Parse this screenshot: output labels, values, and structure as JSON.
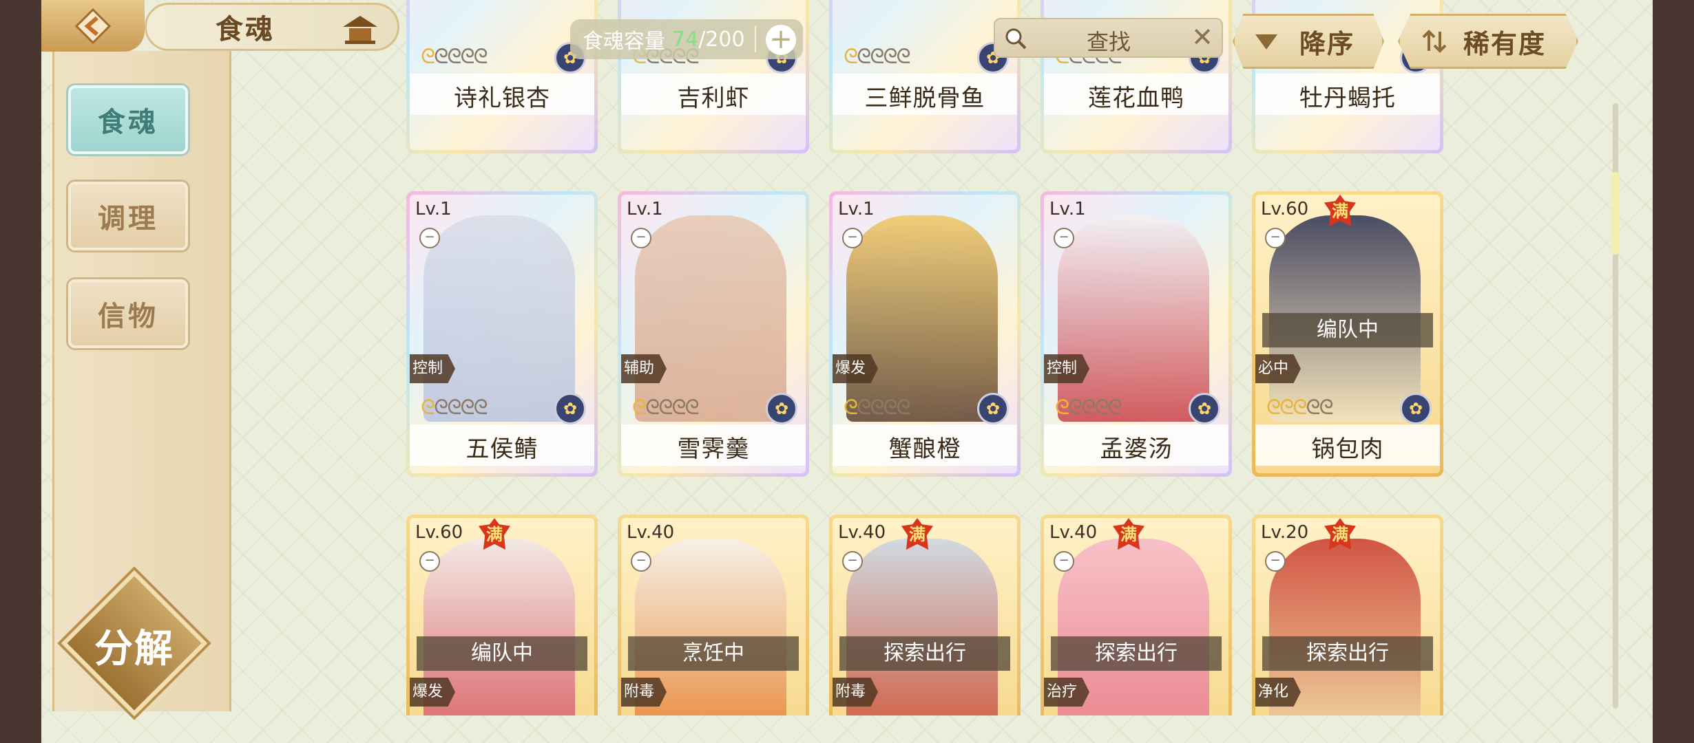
{
  "header": {
    "title": "食魂",
    "capacity_label": "食魂容量",
    "capacity_used": "74",
    "capacity_total": "/200",
    "search_text": "查找",
    "sort_label": "降序",
    "rarity_label": "稀有度"
  },
  "sidebar": {
    "items": [
      {
        "label": "食魂",
        "active": true
      },
      {
        "label": "调理",
        "active": false
      },
      {
        "label": "信物",
        "active": false
      }
    ],
    "decompose_label": "分解"
  },
  "cards": {
    "row0": [
      {
        "name": "诗礼银杏"
      },
      {
        "name": "吉利虾"
      },
      {
        "name": "三鲜脱骨鱼"
      },
      {
        "name": "莲花血鸭"
      },
      {
        "name": "牡丹蝎托"
      }
    ],
    "row1": [
      {
        "name": "五侯鲭",
        "level": "Lv.1",
        "role": "控制",
        "stars": 1
      },
      {
        "name": "雪霁羹",
        "level": "Lv.1",
        "role": "辅助",
        "stars": 1
      },
      {
        "name": "蟹酿橙",
        "level": "Lv.1",
        "role": "爆发",
        "stars": 1
      },
      {
        "name": "孟婆汤",
        "level": "Lv.1",
        "role": "控制",
        "stars": 1
      },
      {
        "name": "锅包肉",
        "level": "Lv.60",
        "role": "必中",
        "stars": 3,
        "status": "编队中",
        "full": "满"
      }
    ],
    "row2": [
      {
        "level": "Lv.60",
        "role": "爆发",
        "status": "编队中",
        "full": "满"
      },
      {
        "level": "Lv.40",
        "role": "附毒",
        "status": "烹饪中"
      },
      {
        "level": "Lv.40",
        "role": "附毒",
        "status": "探索出行",
        "full": "满"
      },
      {
        "level": "Lv.40",
        "role": "治疗",
        "status": "探索出行",
        "full": "满"
      },
      {
        "level": "Lv.20",
        "role": "净化",
        "status": "探索出行",
        "full": "满"
      }
    ]
  },
  "colors": {
    "background": "#ebeedb",
    "accent_gold": "#c99b55",
    "active_tab": "#9ed5d0",
    "full_badge": "#d8351d"
  }
}
